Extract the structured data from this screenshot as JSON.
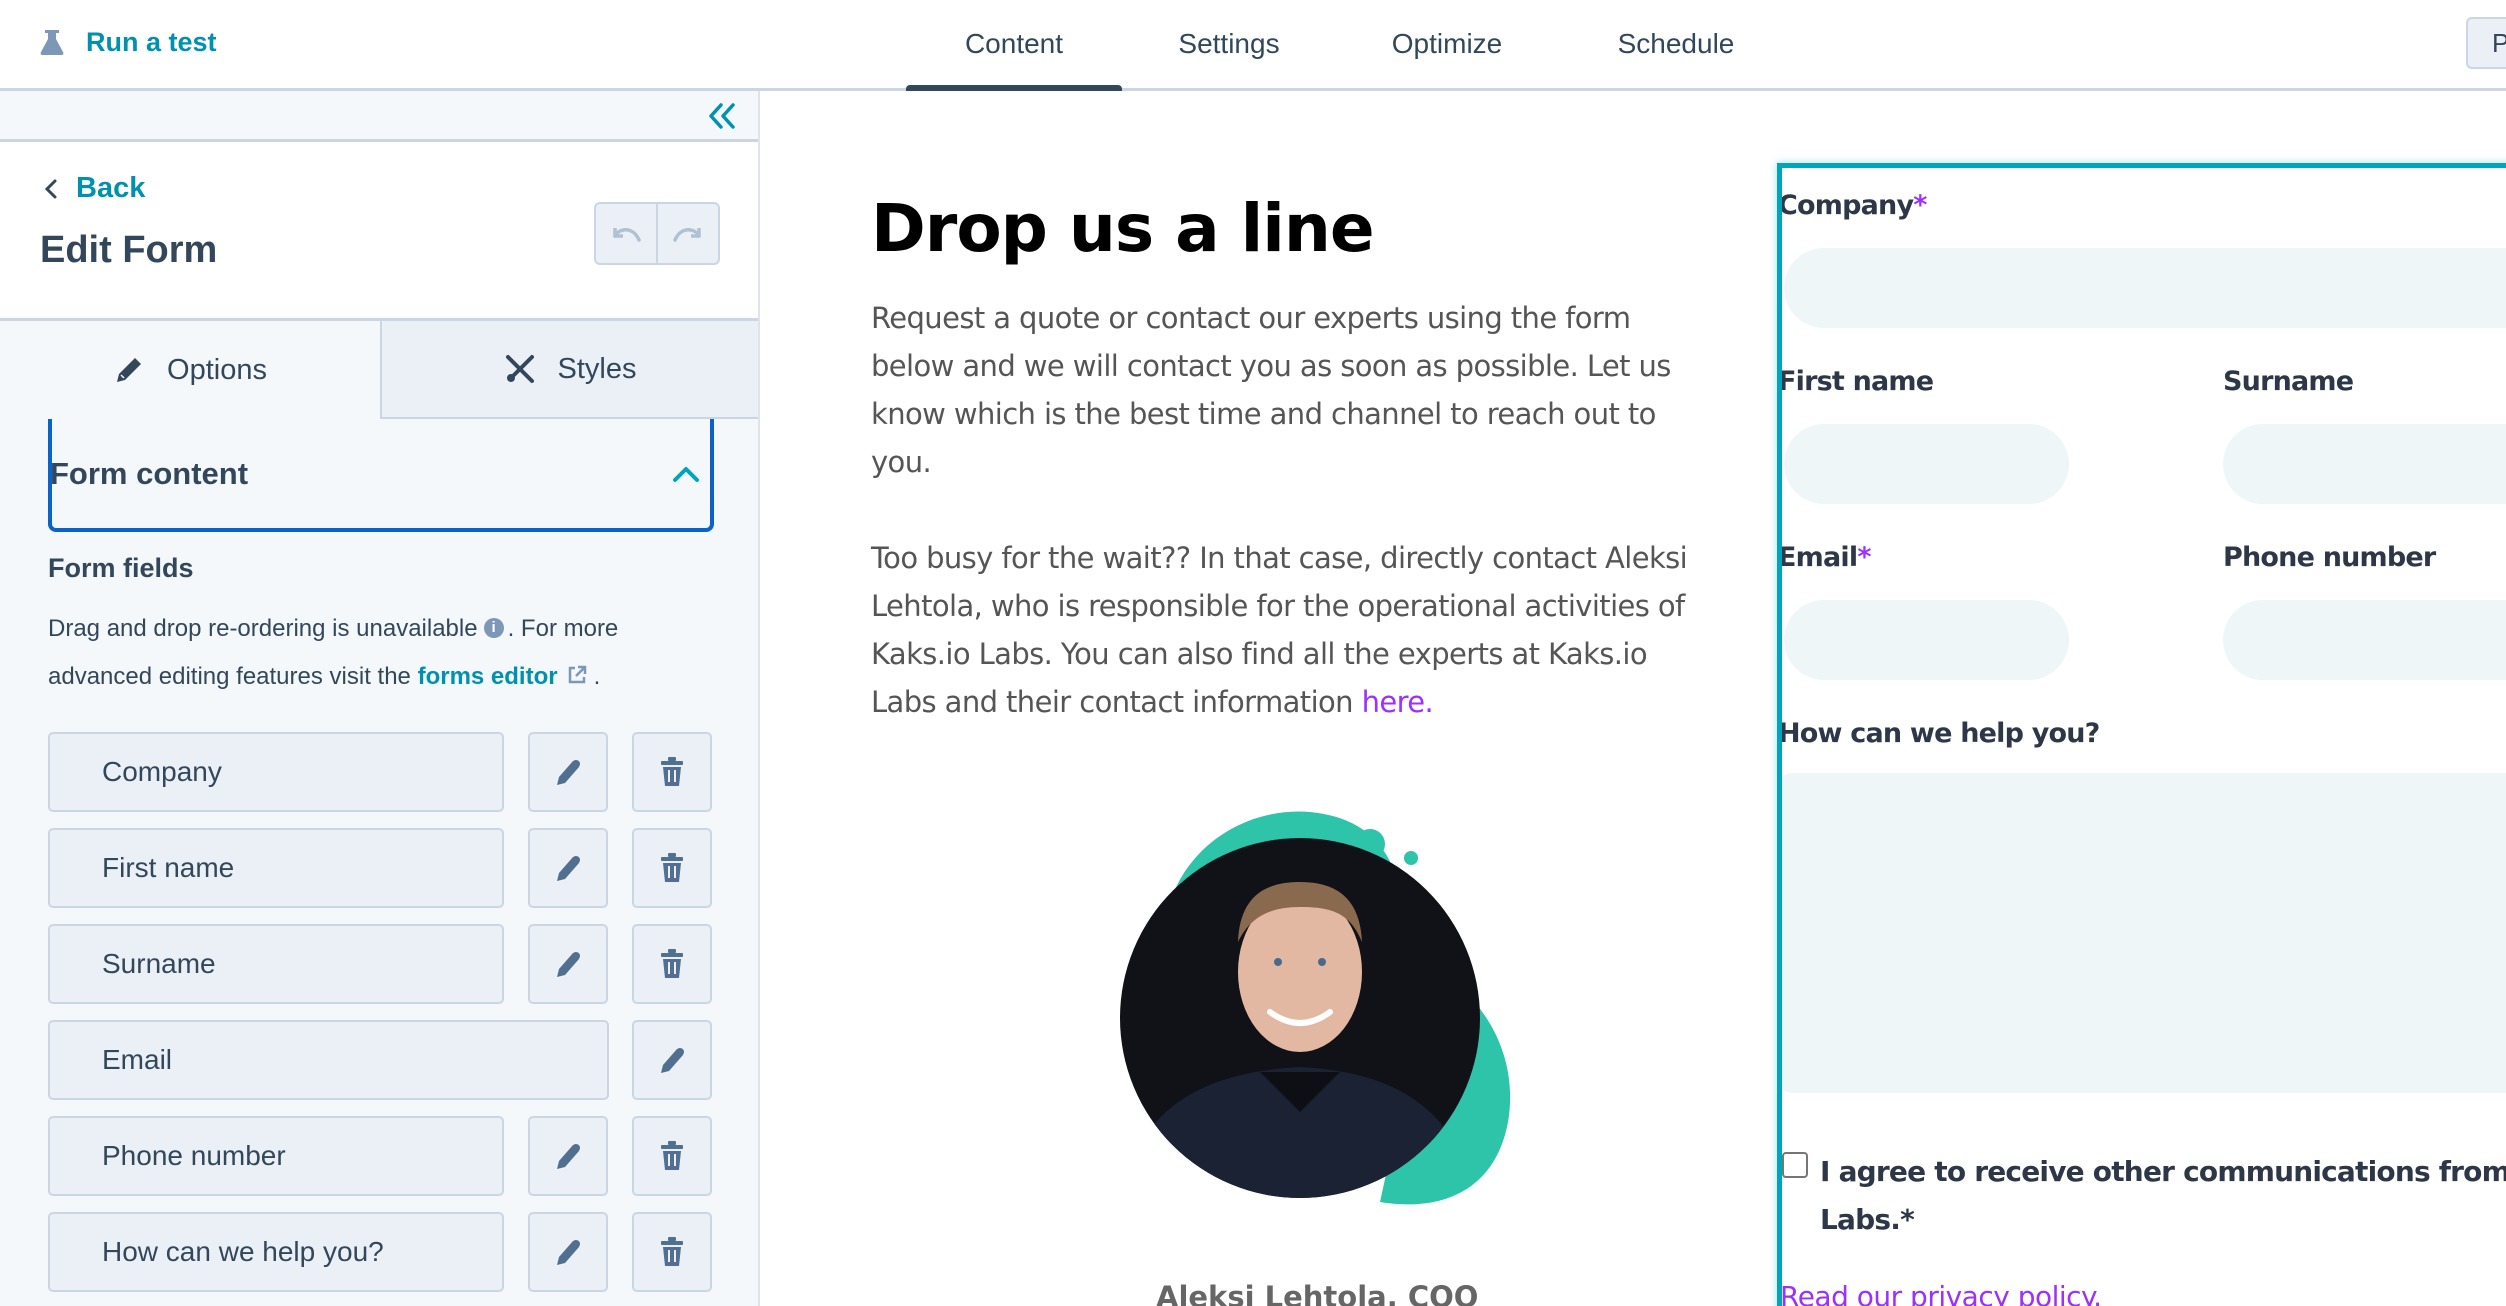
{
  "header": {
    "run_test_label": "Run a test",
    "tabs": [
      {
        "label": "Content",
        "active": true
      },
      {
        "label": "Settings",
        "active": false
      },
      {
        "label": "Optimize",
        "active": false
      },
      {
        "label": "Schedule",
        "active": false
      }
    ],
    "publish_button_partial": "P"
  },
  "sidebar": {
    "back_label": "Back",
    "title": "Edit Form",
    "tabs": [
      {
        "label": "Options",
        "icon": "pencil-icon",
        "active": true
      },
      {
        "label": "Styles",
        "icon": "brush-tools-icon",
        "active": false
      }
    ],
    "section": {
      "title": "Form content",
      "expanded": true
    },
    "form_fields_title": "Form fields",
    "help_text_1": "Drag and drop re-ordering is unavailable",
    "help_text_2": ". For more advanced editing features visit the",
    "forms_editor_link": "forms editor",
    "help_text_end": ".",
    "fields": [
      {
        "label": "Company",
        "deletable": true
      },
      {
        "label": "First name",
        "deletable": true
      },
      {
        "label": "Surname",
        "deletable": true
      },
      {
        "label": "Email",
        "deletable": false
      },
      {
        "label": "Phone number",
        "deletable": true
      },
      {
        "label": "How can we help you?",
        "deletable": true
      }
    ]
  },
  "page": {
    "heading": "Drop us a line",
    "paragraph_1": "Request a quote or contact our experts using the form below and we will contact you as soon as possible. Let us know which is the best time and channel to reach out to you.",
    "paragraph_2": "Too busy for the wait?? In that case, directly contact Aleksi Lehtola, who is responsible for the operational activities of Kaks.io Labs. You can also find all the experts at Kaks.io Labs and their contact information ",
    "paragraph_2_link": "here.",
    "portrait_caption": "Aleksi Lehtola, COO",
    "accent_color": "#2ec4a9",
    "link_color": "#9b30ff"
  },
  "form": {
    "company_label": "Company",
    "first_name_label": "First name",
    "surname_label": "Surname",
    "email_label": "Email",
    "phone_label": "Phone number",
    "help_label": "How can we help you?",
    "required_mark": "*",
    "consent_line_1": "I agree to receive other communications from K",
    "consent_line_2": "Labs.*",
    "privacy_link": "Read our privacy policy."
  }
}
